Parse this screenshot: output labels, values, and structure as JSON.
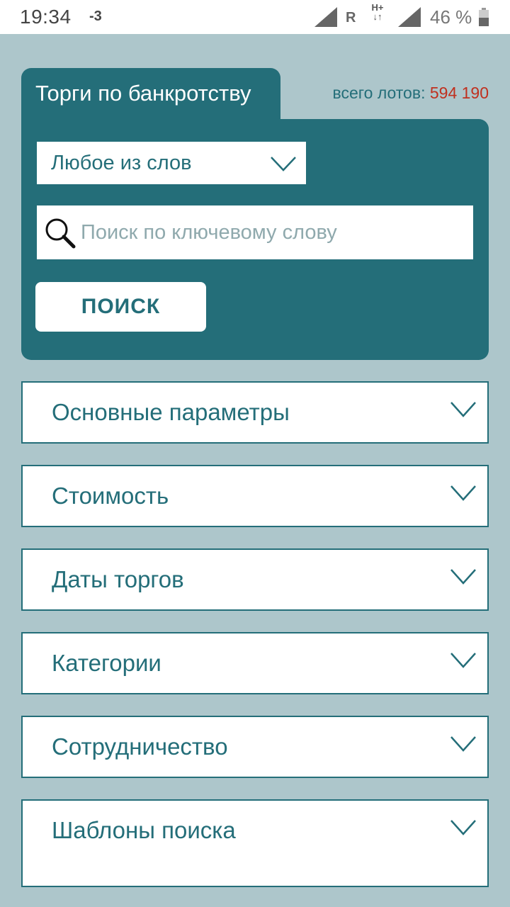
{
  "status_bar": {
    "time": "19:34",
    "notification": "-3",
    "roaming": "R",
    "network_top": "H+",
    "network_bottom": "↓↑",
    "battery": "46 %"
  },
  "search_panel": {
    "tab_label": "Торги по банкротству",
    "lots_label": "всего лотов:",
    "lots_count": "594 190",
    "match_mode": "Любое из слов",
    "search_placeholder": "Поиск по ключевому слову",
    "search_value": "",
    "search_button": "ПОИСК"
  },
  "filters": [
    {
      "label": "Основные параметры"
    },
    {
      "label": "Стоимость"
    },
    {
      "label": "Даты торгов"
    },
    {
      "label": "Категории"
    },
    {
      "label": "Сотрудничество"
    },
    {
      "label": "Шаблоны поиска"
    }
  ],
  "colors": {
    "background": "#adc6cb",
    "accent": "#246e79",
    "count": "#c0301f",
    "surface": "#ffffff"
  }
}
